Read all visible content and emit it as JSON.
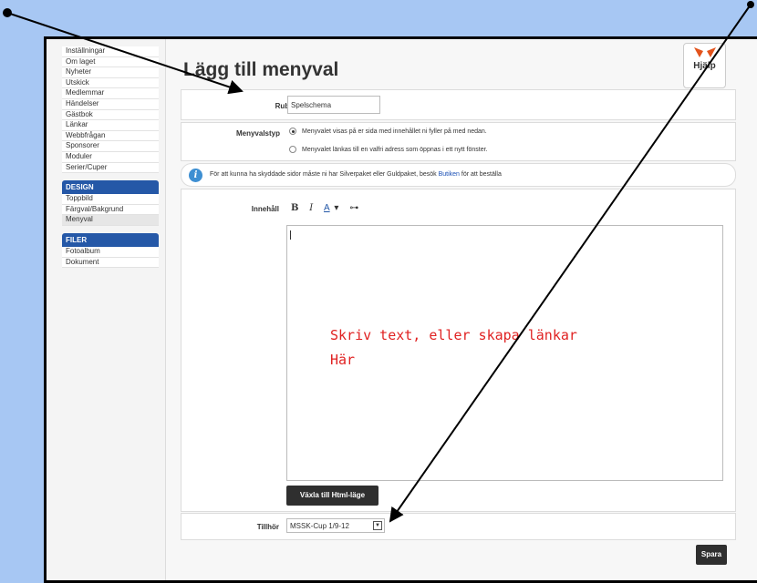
{
  "sidebar": {
    "top_items": [
      "Inställningar",
      "Om laget",
      "Nyheter",
      "Utskick",
      "Medlemmar",
      "Händelser",
      "Gästbok",
      "Länkar",
      "Webbfrågan",
      "Sponsorer",
      "Moduler",
      "Serier/Cuper"
    ],
    "design": {
      "header": "DESIGN",
      "items": [
        "Toppbild",
        "Färgval/Bakgrund",
        "Menyval"
      ]
    },
    "filer": {
      "header": "FILER",
      "items": [
        "Fotoalbum",
        "Dokument"
      ]
    }
  },
  "main": {
    "title": "Lägg till menyval",
    "help_label": "Hjälp",
    "rubrik": {
      "label": "Rubrik",
      "value": "Spelschema"
    },
    "menyvalstyp": {
      "label": "Menyvalstyp",
      "options": [
        "Menyvalet visas på er sida med innehållet ni fyller på med nedan.",
        "Menyvalet länkas till en valfri adress som öppnas i ett nytt fönster."
      ],
      "selected_index": 0
    },
    "info": {
      "text_before": "För att kunna ha skyddade sidor måste ni har Silverpaket eller Guldpaket, besök ",
      "link": "Butiken",
      "text_after": " för att beställa"
    },
    "innehall_label": "Innehåll",
    "toolbar": {
      "bold": "B",
      "italic": "I",
      "color": "A",
      "dropdown": "▾",
      "link": "⊶"
    },
    "editor_text": "Skriv text, eller skapa länkar\nHär",
    "toggle_html": "Växla till Html-läge",
    "tillhor": {
      "label": "Tillhör",
      "value": "MSSK-Cup 1/9-12",
      "arrow": "▼"
    },
    "save": "Spara"
  },
  "colors": {
    "accent": "#2558a7",
    "annotation": "#e02222",
    "background": "#a7c7f3"
  }
}
